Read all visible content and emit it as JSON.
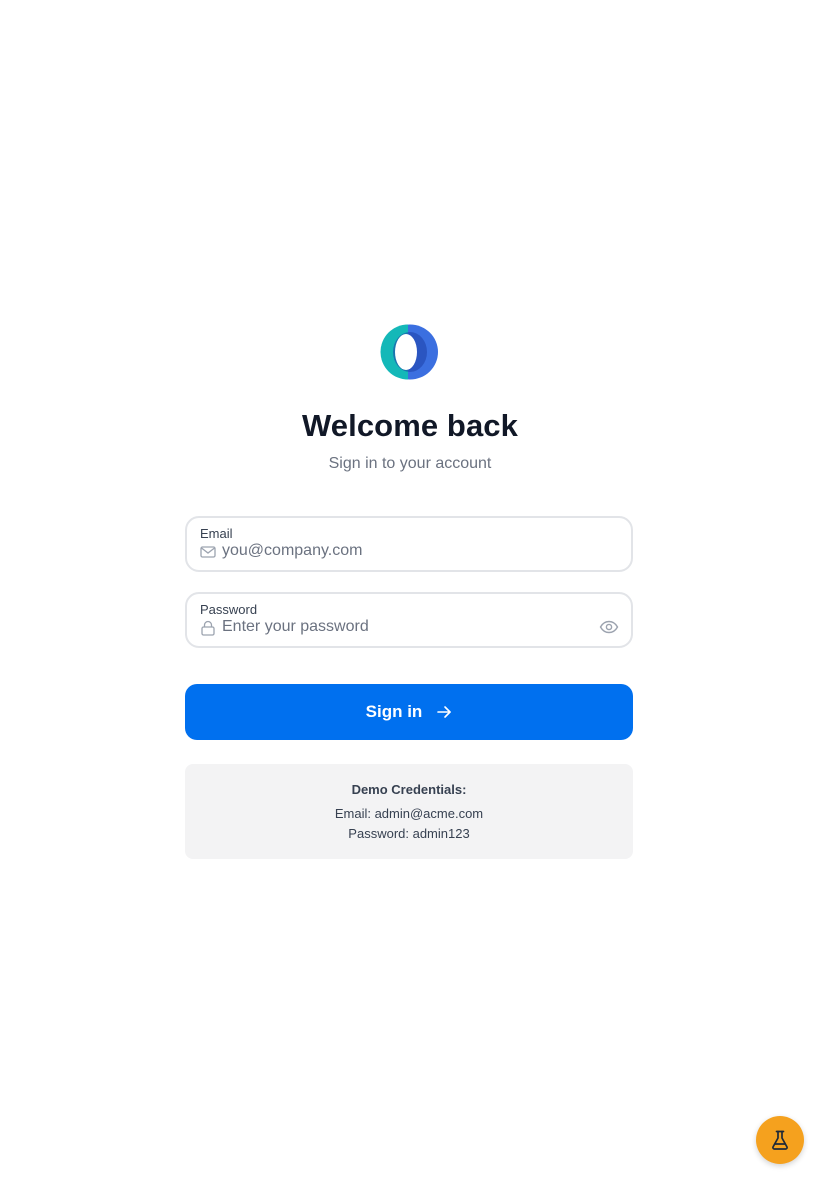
{
  "brand": {
    "logo_icon": "crescent-ring-logo-icon",
    "colors": {
      "teal": "#14b8b8",
      "blue": "#3b6fe0"
    }
  },
  "header": {
    "title": "Welcome back",
    "subtitle": "Sign in to your account"
  },
  "form": {
    "email": {
      "label": "Email",
      "placeholder": "you@company.com",
      "value": "",
      "icon": "mail-icon"
    },
    "password": {
      "label": "Password",
      "placeholder": "Enter your password",
      "value": "",
      "icon": "lock-icon",
      "toggle_icon": "eye-icon"
    },
    "submit": {
      "label": "Sign in",
      "icon": "arrow-right-icon",
      "color": "#0070ef"
    }
  },
  "demo": {
    "title": "Demo Credentials:",
    "email_line": "Email: admin@acme.com",
    "password_line": "Password: admin123"
  },
  "fab": {
    "icon": "flask-icon",
    "color": "#f5a11e"
  }
}
